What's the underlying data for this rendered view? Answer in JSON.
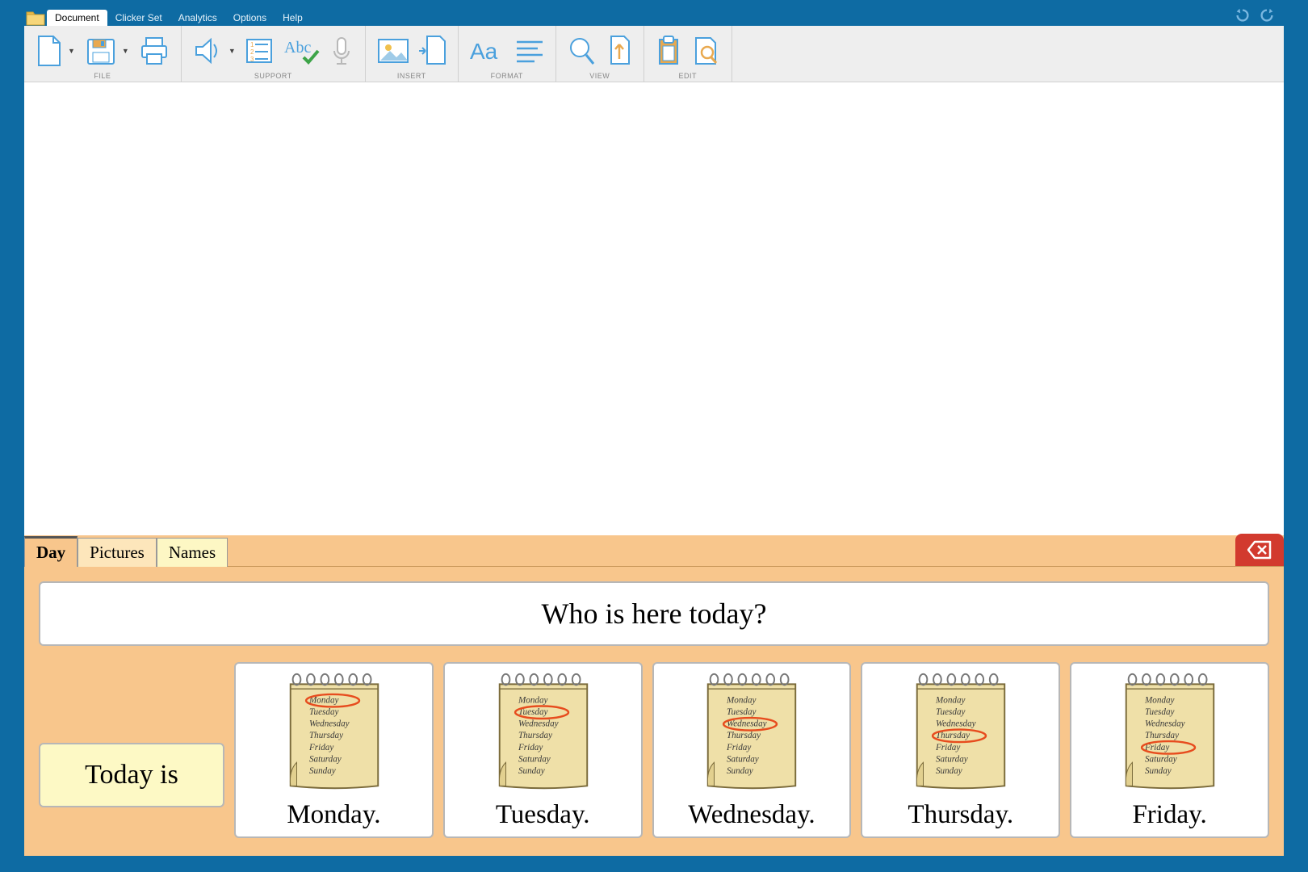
{
  "menu": {
    "tabs": [
      "Document",
      "Clicker Set",
      "Analytics",
      "Options",
      "Help"
    ],
    "active_tab": "Document"
  },
  "toolbar_groups": {
    "file": "FILE",
    "support": "SUPPORT",
    "insert": "INSERT",
    "format": "FORMAT",
    "view": "VIEW",
    "edit": "EDIT"
  },
  "grid": {
    "tabs": [
      "Day",
      "Pictures",
      "Names"
    ],
    "active_tab": "Day",
    "question": "Who is here today?",
    "prompt": "Today is",
    "days": [
      {
        "label": "Monday.",
        "circled_index": 0
      },
      {
        "label": "Tuesday.",
        "circled_index": 1
      },
      {
        "label": "Wednesday.",
        "circled_index": 2
      },
      {
        "label": "Thursday.",
        "circled_index": 3
      },
      {
        "label": "Friday.",
        "circled_index": 4
      }
    ],
    "notepad_days": [
      "Monday",
      "Tuesday",
      "Wednesday",
      "Thursday",
      "Friday",
      "Saturday",
      "Sunday"
    ]
  }
}
